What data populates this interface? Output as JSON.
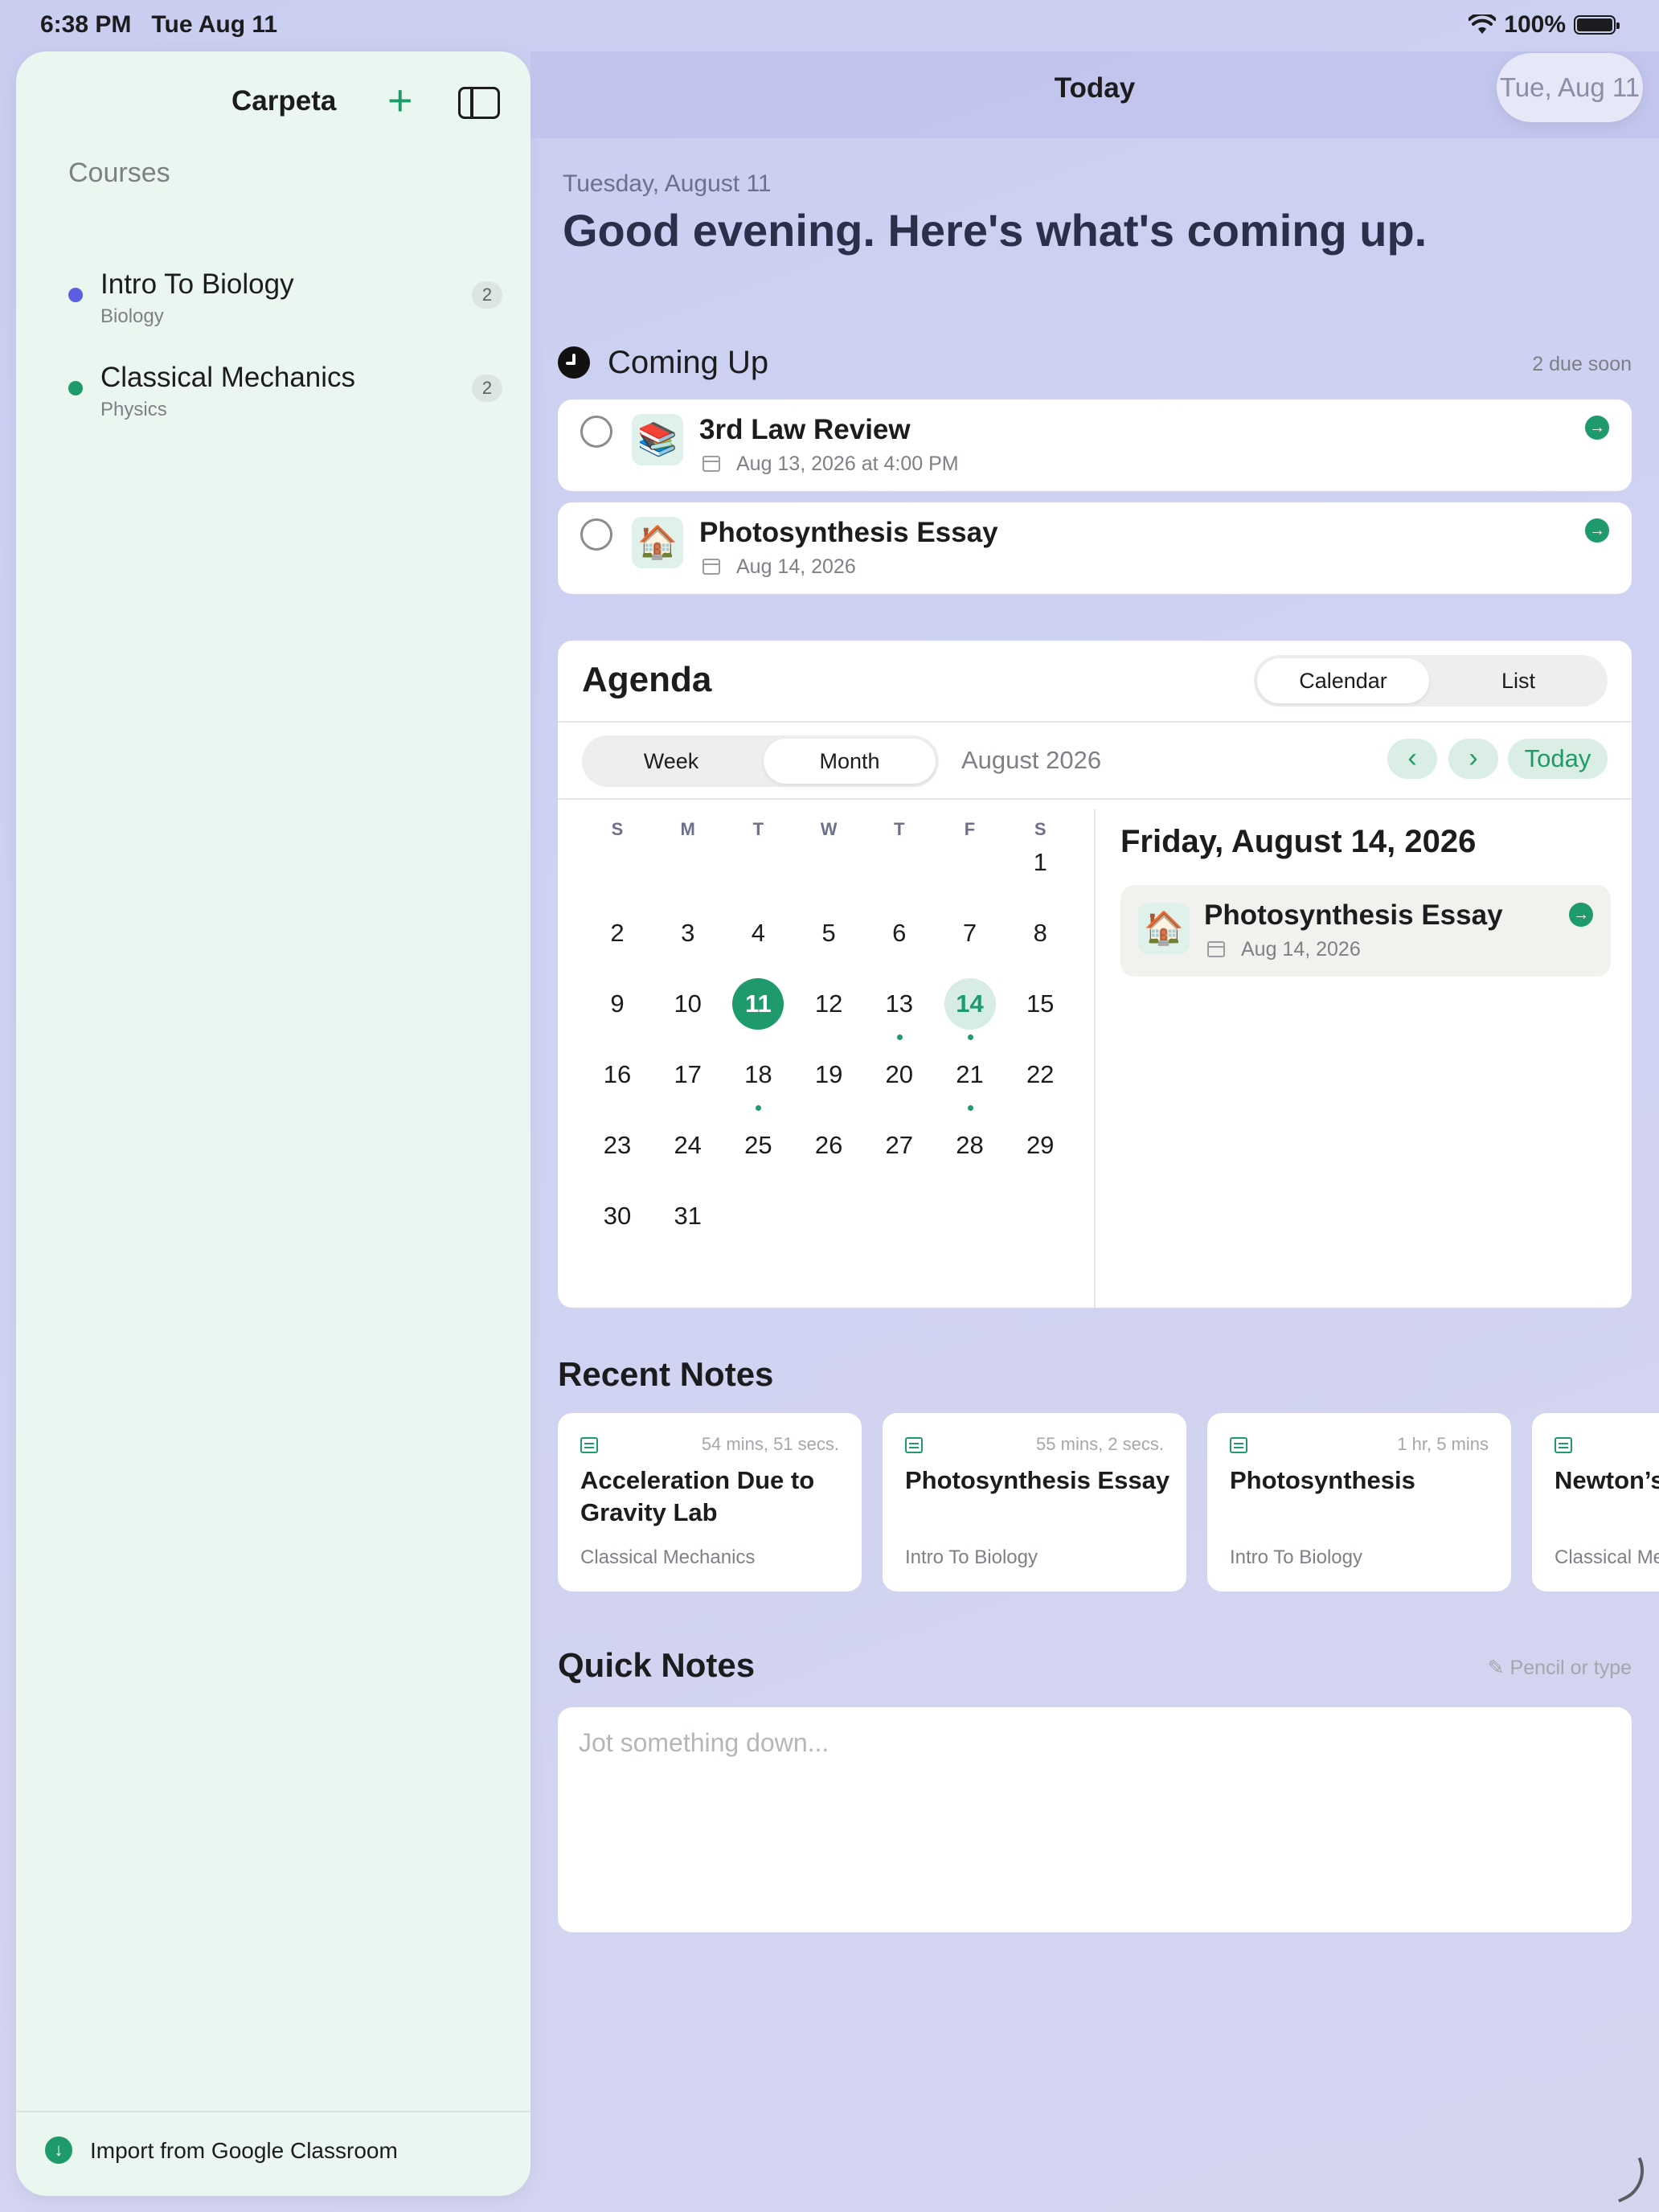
{
  "status_bar": {
    "time": "6:38 PM",
    "date": "Tue Aug 11",
    "battery": "100%"
  },
  "sidebar": {
    "title": "Carpeta",
    "courses_heading": "Courses",
    "courses": [
      {
        "name": "Intro To Biology",
        "subject": "Biology",
        "count": "2",
        "color": "#5b5ee0"
      },
      {
        "name": "Classical Mechanics",
        "subject": "Physics",
        "count": "2",
        "color": "#1f9a6c"
      }
    ],
    "footer_label": "Import from Google Classroom"
  },
  "topbar": {
    "title": "Today",
    "date_pill": "Tue, Aug 11"
  },
  "header": {
    "date_line": "Tuesday, August 11",
    "greeting": "Good evening. Here's what's coming up."
  },
  "coming_up": {
    "title": "Coming Up",
    "meta": "2 due soon",
    "tasks": [
      {
        "emoji": "📚",
        "title": "3rd Law Review",
        "date": "Aug 13, 2026 at 4:00 PM"
      },
      {
        "emoji": "🏠",
        "title": "Photosynthesis Essay",
        "date": "Aug 14, 2026"
      }
    ]
  },
  "agenda": {
    "title": "Agenda",
    "view_options": [
      "Calendar",
      "List"
    ],
    "view_selected": "Calendar",
    "range_options": [
      "Week",
      "Month"
    ],
    "range_selected": "Month",
    "month_label": "August 2026",
    "today_label": "Today",
    "weekdays": [
      "S",
      "M",
      "T",
      "W",
      "T",
      "F",
      "S"
    ],
    "first_weekday_index": 6,
    "days_in_month": 31,
    "today": 11,
    "selected": 14,
    "event_days": [
      13,
      14,
      18,
      21
    ],
    "selected_date_label": "Friday, August 14, 2026",
    "selected_events": [
      {
        "emoji": "🏠",
        "title": "Photosynthesis Essay",
        "date": "Aug 14, 2026"
      }
    ]
  },
  "recent_notes": {
    "title": "Recent Notes",
    "notes": [
      {
        "time": "54 mins, 51 secs.",
        "title": "Acceleration Due to Gravity Lab",
        "course": "Classical Mechanics"
      },
      {
        "time": "55 mins, 2 secs.",
        "title": "Photosynthesis Essay",
        "course": "Intro To Biology"
      },
      {
        "time": "1 hr, 5 mins",
        "title": "Photosynthesis",
        "course": "Intro To Biology"
      },
      {
        "time": "",
        "title": "Newton’s",
        "course": "Classical Mechanics"
      }
    ]
  },
  "quick_notes": {
    "title": "Quick Notes",
    "hint": "Pencil or type",
    "placeholder": "Jot something down..."
  }
}
